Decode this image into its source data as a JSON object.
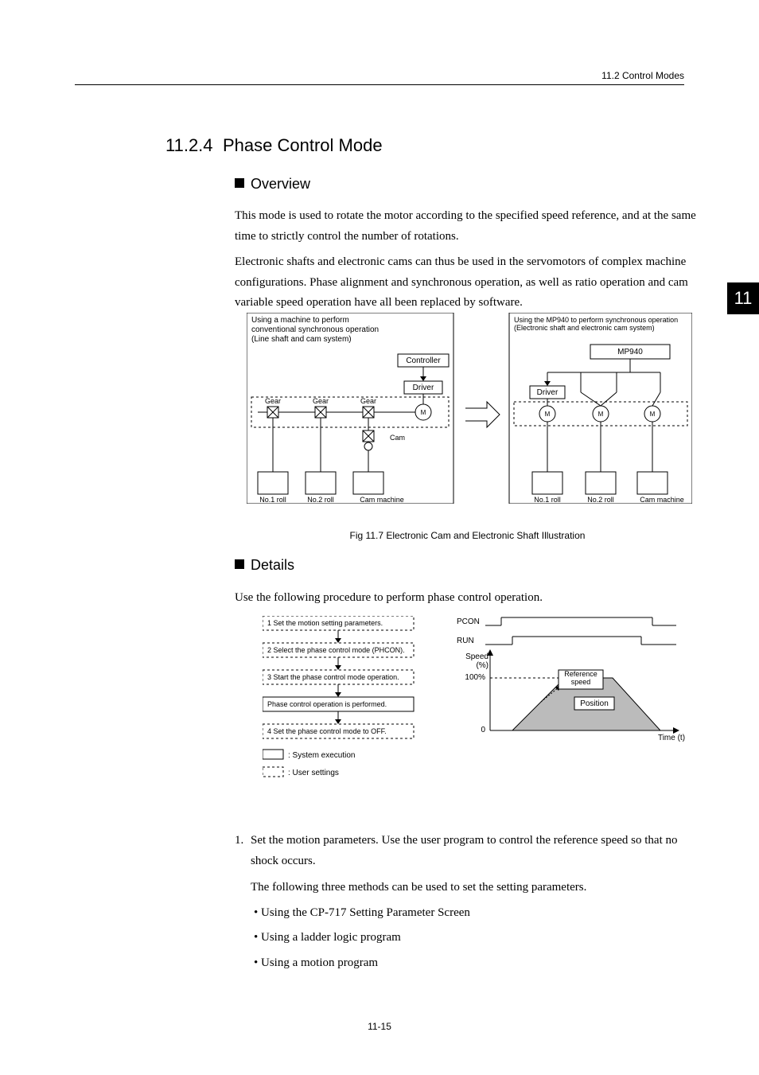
{
  "header": {
    "running_head": "11.2  Control Modes"
  },
  "section": {
    "number": "11.2.4",
    "title": "Phase Control Mode"
  },
  "sub": {
    "overview": "Overview",
    "details": "Details"
  },
  "paragraphs": {
    "p1": "This mode is used to rotate the motor according to the specified speed reference, and at the same time to strictly control the number of rotations.",
    "p2": "Electronic shafts and electronic cams can thus be used in the servomotors of complex machine configurations. Phase alignment and synchronous operation, as well as ratio operation and cam variable speed operation have all been replaced by software.",
    "details_intro": "Use the following procedure to perform phase control operation."
  },
  "figure_caption": "Fig 11.7  Electronic Cam and Electronic Shaft Illustration",
  "side_tab": "11",
  "fig1": {
    "left_title": "Using a machine to perform conventional synchronous operation (Line shaft and cam system)",
    "right_title": "Using the MP940 to perform synchronous operation (Electronic shaft and electronic cam system)",
    "controller": "Controller",
    "driver": "Driver",
    "gear": "Gear",
    "cam": "Cam",
    "m": "M",
    "mp940": "MP940",
    "no1": "No.1 roll",
    "no2": "No.2 roll",
    "camm": "Cam machine"
  },
  "procedure": {
    "step1": "1 Set the motion setting parameters.",
    "step2": "2 Select the phase control mode (PHCON).",
    "step3": "3 Start the phase control mode operation.",
    "step4": "Phase control operation is performed.",
    "step5": "4 Set the phase control mode to OFF.",
    "legend_sys": ": System execution",
    "legend_user": ": User settings",
    "pcon": "PCON",
    "run": "RUN",
    "speed_pct": "Speed (%)",
    "hundred": "100%",
    "zero": "0",
    "ref_speed": "Reference speed",
    "position": "Position",
    "time": "Time (t)"
  },
  "list": {
    "item1_num": "1.",
    "item1": "Set the motion parameters. Use the user program to control the reference speed so that no shock occurs.",
    "item1_sub": "The following three methods can be used to set the setting parameters.",
    "bullet1": "Using the CP-717 Setting Parameter Screen",
    "bullet2": "Using a ladder logic program",
    "bullet3": "Using a motion program"
  },
  "footer": {
    "page_number": "11-15"
  }
}
